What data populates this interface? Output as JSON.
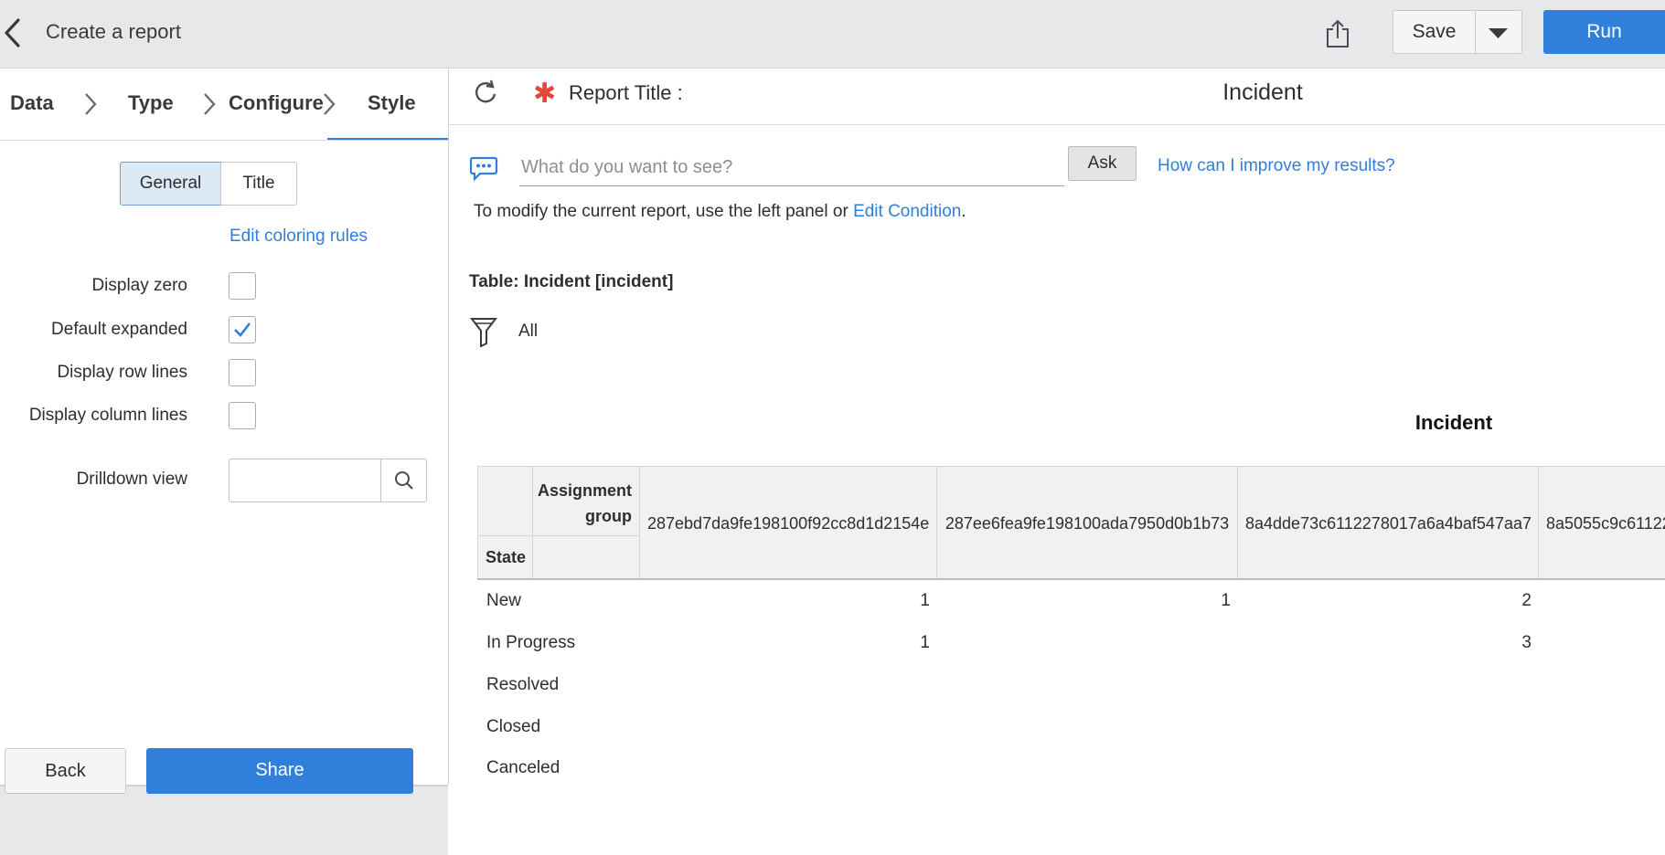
{
  "header": {
    "title": "Create a report",
    "save_label": "Save",
    "run_label": "Run"
  },
  "steps": [
    "Data",
    "Type",
    "Configure",
    "Style"
  ],
  "style_panel": {
    "tabs": [
      "General",
      "Title"
    ],
    "edit_coloring_rules": "Edit coloring rules",
    "options": [
      {
        "label": "Display zero",
        "checked": false
      },
      {
        "label": "Default expanded",
        "checked": true
      },
      {
        "label": "Display row lines",
        "checked": false
      },
      {
        "label": "Display column lines",
        "checked": false
      }
    ],
    "drilldown_label": "Drilldown view",
    "drilldown_value": ""
  },
  "footer": {
    "back_label": "Back",
    "share_label": "Share"
  },
  "report": {
    "title_label": "Report Title :",
    "title_value": "Incident",
    "ask_placeholder": "What do you want to see?",
    "ask_button": "Ask",
    "improve_link": "How can I improve my results?",
    "modify_text": "To modify the current report, use the left panel or",
    "edit_condition": "Edit Condition",
    "modify_period": ".",
    "table_label": "Table: Incident [incident]",
    "filter_value": "All",
    "chart_title": "Incident"
  },
  "pivot": {
    "column_group_label": "Assignment group",
    "row_group_label": "State",
    "columns": [
      "287ebd7da9fe198100f92cc8d1d2154e",
      "287ee6fea9fe198100ada7950d0b1b73",
      "8a4dde73c6112278017a6a4baf547aa7",
      "8a5055c9c61122"
    ],
    "rows": [
      {
        "state": "New",
        "values": [
          "1",
          "1",
          "2",
          ""
        ]
      },
      {
        "state": "In Progress",
        "values": [
          "1",
          "",
          "3",
          ""
        ]
      },
      {
        "state": "Resolved",
        "values": [
          "",
          "",
          "",
          ""
        ]
      },
      {
        "state": "Closed",
        "values": [
          "",
          "",
          "",
          ""
        ]
      },
      {
        "state": "Canceled",
        "values": [
          "",
          "",
          "",
          ""
        ]
      }
    ]
  },
  "colors": {
    "accent": "#2f7fdb",
    "required": "#e8443a",
    "header_bg": "#e6e8ea"
  }
}
